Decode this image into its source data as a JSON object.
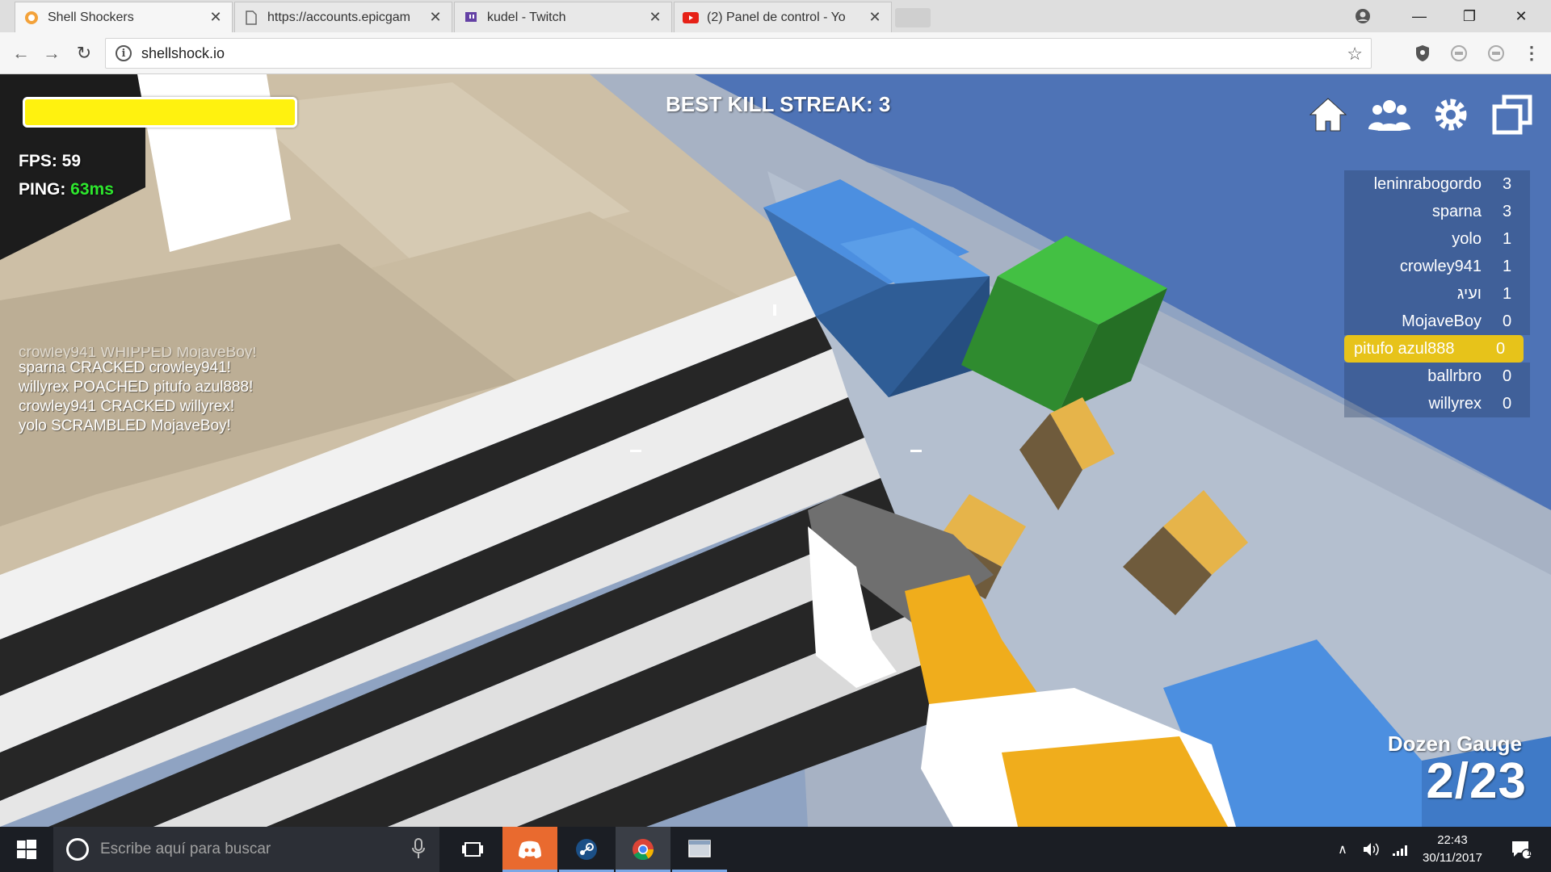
{
  "browser": {
    "tabs": [
      {
        "title": "Shell Shockers",
        "active": true
      },
      {
        "title": "https://accounts.epicgam",
        "active": false
      },
      {
        "title": "kudel - Twitch",
        "active": false
      },
      {
        "title": "(2) Panel de control - Yo",
        "active": false
      }
    ],
    "url": "shellshock.io"
  },
  "hud": {
    "health_fraction": 1.0,
    "fps_label": "FPS: 59",
    "ping_label": "PING: ",
    "ping_value": "63ms",
    "best_kill_streak": "BEST KILL STREAK: 3",
    "killfeed": [
      "crowley941 WHIPPED MojaveBoy!",
      "sparna CRACKED crowley941!",
      "willyrex POACHED pitufo azul888!",
      "crowley941 CRACKED willyrex!",
      "yolo SCRAMBLED MojaveBoy!"
    ],
    "scoreboard": [
      {
        "name": "leninrabogordo",
        "score": "3",
        "me": false
      },
      {
        "name": "sparna",
        "score": "3",
        "me": false
      },
      {
        "name": "yolo",
        "score": "1",
        "me": false
      },
      {
        "name": "crowley941",
        "score": "1",
        "me": false
      },
      {
        "name": "ועיג",
        "score": "1",
        "me": false
      },
      {
        "name": "MojaveBoy",
        "score": "0",
        "me": false
      },
      {
        "name": "pitufo azul888",
        "score": "0",
        "me": true
      },
      {
        "name": "ballrbro",
        "score": "0",
        "me": false
      },
      {
        "name": "willyrex",
        "score": "0",
        "me": false
      }
    ],
    "weapon_name": "Dozen Gauge",
    "ammo": "2/23",
    "icons": [
      "home-icon",
      "friends-icon",
      "settings-icon",
      "fullscreen-icon"
    ]
  },
  "taskbar": {
    "search_placeholder": "Escribe aquí para buscar",
    "time": "22:43",
    "date": "30/11/2017",
    "notification_count": "1",
    "apps": [
      "discord-icon",
      "steam-icon",
      "chrome-icon",
      "game-window-icon"
    ]
  },
  "colors": {
    "health": "#fff20f",
    "ping_ok": "#2ee62e",
    "highlight_row": "#e7c31a"
  }
}
